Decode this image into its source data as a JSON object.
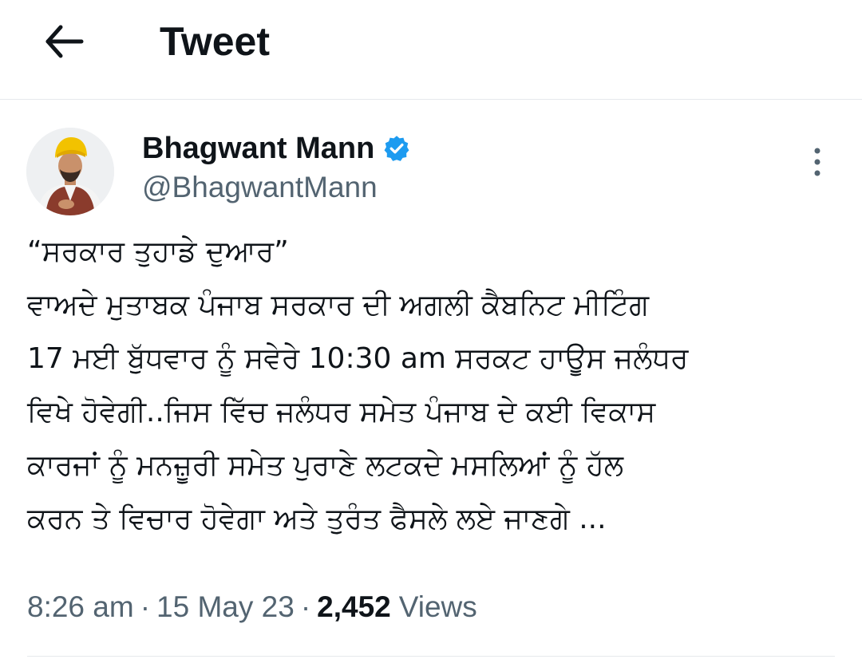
{
  "header": {
    "back_icon": "arrow-left-icon",
    "title": "Tweet"
  },
  "author": {
    "name": "Bhagwant Mann",
    "handle": "@BhagwantMann",
    "verified_icon": "verified-badge-icon",
    "verified_color": "#1d9bf0",
    "more_icon": "more-vertical-icon"
  },
  "tweet": {
    "lines": [
      "“ਸਰਕਾਰ ਤੁਹਾਡੇ ਦੁਆਰ”",
      "ਵਾਅਦੇ ਮੁਤਾਬਕ ਪੰਜਾਬ ਸਰਕਾਰ ਦੀ ਅਗਲੀ ਕੈਬਨਿਟ ਮੀਟਿੰਗ",
      "17 ਮਈ ਬੁੱਧਵਾਰ ਨੂੰ ਸਵੇਰੇ 10:30 am ਸਰਕਟ ਹਾਊਸ ਜਲੰਧਰ",
      "ਵਿਖੇ ਹੋਵੇਗੀ..ਜਿਸ ਵਿੱਚ ਜਲੰਧਰ ਸਮੇਤ ਪੰਜਾਬ ਦੇ ਕਈ ਵਿਕਾਸ",
      "ਕਾਰਜਾਂ ਨੂੰ ਮਨਜ਼ੂਰੀ ਸਮੇਤ ਪੁਰਾਣੇ ਲਟਕਦੇ ਮਸਲਿਆਂ ਨੂੰ ਹੱਲ",
      "ਕਰਨ ਤੇ ਵਿਚਾਰ ਹੋਵੇਗਾ ਅਤੇ ਤੁਰੰਤ ਫੈਸਲੇ ਲਏ ਜਾਣਗੇ ..."
    ]
  },
  "meta": {
    "time": "8:26 am",
    "separator": "·",
    "date": "15 May 23",
    "views_count": "2,452",
    "views_label": "Views"
  },
  "colors": {
    "text_primary": "#0f1419",
    "text_secondary": "#536471",
    "divider": "#e6e9ec",
    "accent": "#1d9bf0"
  }
}
